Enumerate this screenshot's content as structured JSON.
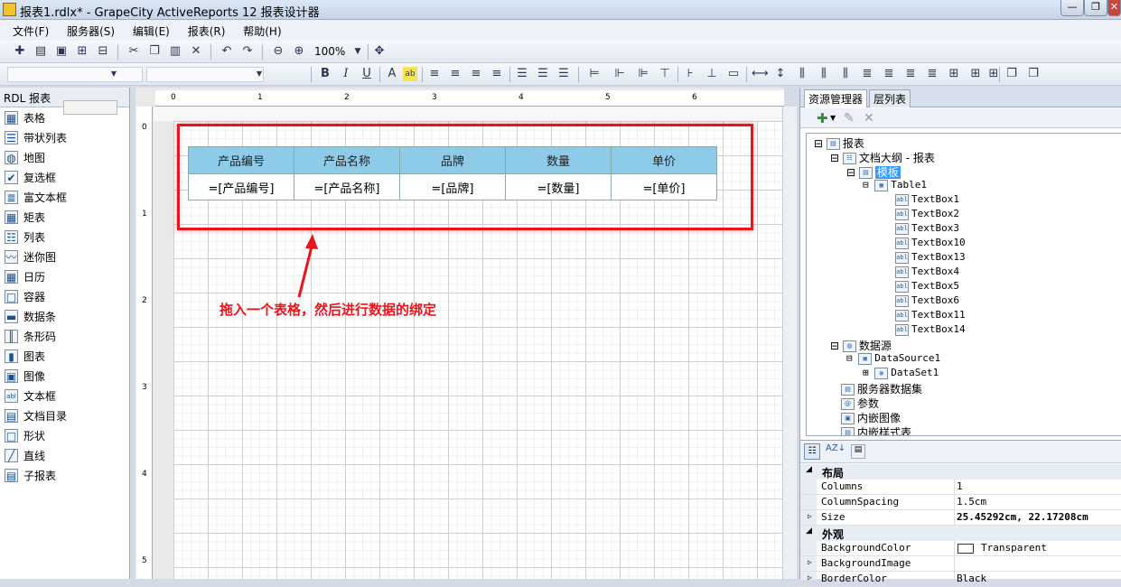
{
  "window": {
    "title": "报表1.rdlx* - GrapeCity ActiveReports 12 报表设计器",
    "minimize": "—",
    "restore": "❐",
    "close": "✕"
  },
  "menu": [
    "文件(F)",
    "服务器(S)",
    "编辑(E)",
    "报表(R)",
    "帮助(H)"
  ],
  "toolbar": {
    "zoom": "100%"
  },
  "toolbox": {
    "header": "RDL 报表",
    "items": [
      "表格",
      "带状列表",
      "地图",
      "复选框",
      "富文本框",
      "矩表",
      "列表",
      "迷你图",
      "日历",
      "容器",
      "数据条",
      "条形码",
      "图表",
      "图像",
      "文本框",
      "文档目录",
      "形状",
      "直线",
      "子报表"
    ]
  },
  "ruler": {
    "h": [
      "0",
      "1",
      "2",
      "3",
      "4",
      "5",
      "6"
    ],
    "v": [
      "0",
      "1",
      "2",
      "3",
      "4",
      "5"
    ]
  },
  "table": {
    "headers": [
      "产品编号",
      "产品名称",
      "品牌",
      "数量",
      "单价"
    ],
    "cells": [
      "=[产品编号]",
      "=[产品名称]",
      "=[品牌]",
      "=[数量]",
      "=[单价]"
    ]
  },
  "annotation": "拖入一个表格，然后进行数据的绑定",
  "explorer": {
    "tab1": "资源管理器",
    "tab2": "层列表",
    "tree": {
      "report": "报表",
      "outline": "文档大纲 - 报表",
      "template": "模板",
      "table": "Table1",
      "textboxes": [
        "TextBox1",
        "TextBox2",
        "TextBox3",
        "TextBox10",
        "TextBox13",
        "TextBox4",
        "TextBox5",
        "TextBox6",
        "TextBox11",
        "TextBox14"
      ],
      "datasources": "数据源",
      "datasource1": "DataSource1",
      "dataset1": "DataSet1",
      "serverdatasets": "服务器数据集",
      "params": "参数",
      "images": "内嵌图像",
      "styles": "内嵌样式表"
    }
  },
  "props": {
    "cat_layout": "布局",
    "cat_appearance": "外观",
    "rows": [
      {
        "k": "Columns",
        "v": "1"
      },
      {
        "k": "ColumnSpacing",
        "v": "1.5cm"
      },
      {
        "k": "Size",
        "v": "25.45292cm, 22.17208cm"
      }
    ],
    "rows2": [
      {
        "k": "BackgroundColor",
        "v": "Transparent"
      },
      {
        "k": "BackgroundImage",
        "v": ""
      },
      {
        "k": "BorderColor",
        "v": "Black"
      }
    ]
  }
}
